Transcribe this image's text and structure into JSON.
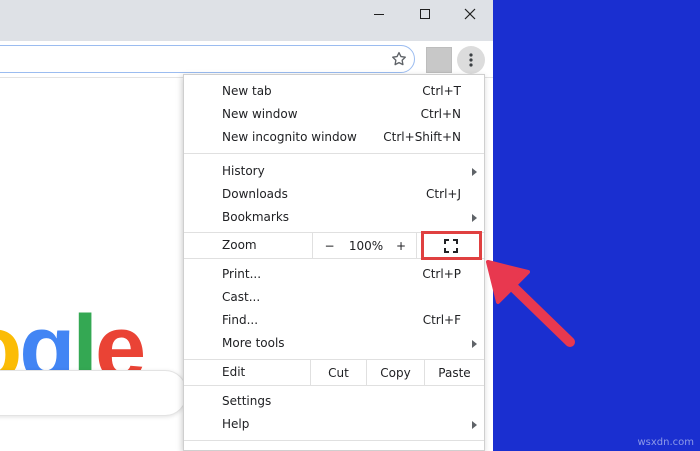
{
  "menu": {
    "group1": [
      {
        "label": "New tab",
        "shortcut": "Ctrl+T"
      },
      {
        "label": "New window",
        "shortcut": "Ctrl+N"
      },
      {
        "label": "New incognito window",
        "shortcut": "Ctrl+Shift+N"
      }
    ],
    "group2": [
      {
        "label": "History",
        "shortcut": ""
      },
      {
        "label": "Downloads",
        "shortcut": "Ctrl+J"
      },
      {
        "label": "Bookmarks",
        "shortcut": ""
      }
    ],
    "zoom": {
      "label": "Zoom",
      "minus": "−",
      "value": "100%",
      "plus": "+"
    },
    "group3": [
      {
        "label": "Print...",
        "shortcut": "Ctrl+P"
      },
      {
        "label": "Cast...",
        "shortcut": ""
      },
      {
        "label": "Find...",
        "shortcut": "Ctrl+F"
      },
      {
        "label": "More tools",
        "shortcut": ""
      }
    ],
    "edit": {
      "label": "Edit",
      "cut": "Cut",
      "copy": "Copy",
      "paste": "Paste"
    },
    "group4": [
      {
        "label": "Settings",
        "shortcut": ""
      },
      {
        "label": "Help",
        "shortcut": ""
      }
    ]
  },
  "logo": {
    "letters": [
      "o",
      "g",
      "l",
      "e"
    ],
    "colors": [
      "#fbbc05",
      "#4285f4",
      "#34a853",
      "#ea4335"
    ]
  },
  "watermark": "wsxdn.com",
  "icons": {
    "minimize": "minimize-icon",
    "maximize": "maximize-icon",
    "close": "close-icon",
    "star": "star-icon",
    "menu": "kebab-menu-icon",
    "fullscreen": "fullscreen-icon",
    "submenu": "chevron-right-icon",
    "annotation": "red-arrow-icon"
  },
  "colors": {
    "highlight": "#e04040",
    "background": "#1a2fd0",
    "titlebar": "#dee1e6"
  }
}
